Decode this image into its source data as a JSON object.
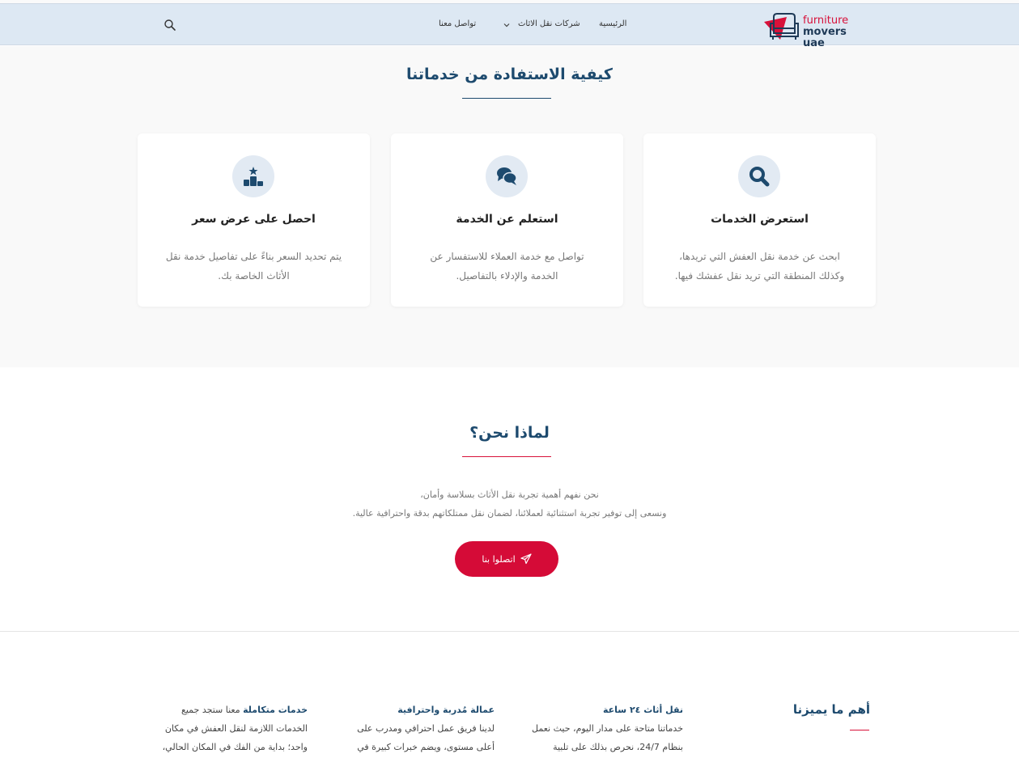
{
  "header": {
    "logo_line1": "furniture",
    "logo_line2": "movers uae",
    "nav": {
      "home": "الرئيسية",
      "companies": "شركات نقل الاثاث",
      "contact": "تواصل معنا"
    },
    "icons": {
      "search": "search-icon",
      "chevron": "chevron-down-icon",
      "logo": "armchair-icon"
    }
  },
  "how": {
    "title": "كيفية الاستفادة من خدماتنا",
    "cards": [
      {
        "icon": "search-icon",
        "title": "استعرض الخدمات",
        "line1": "ابحث عن خدمة نقل العفش التي تريدها،",
        "line2": "وكذلك المنطقة التي تريد نقل عفشك فيها."
      },
      {
        "icon": "chat-icon",
        "title": "استعلم عن الخدمة",
        "line1": "تواصل مع خدمة العملاء للاستفسار عن",
        "line2": "الخدمة والإدلاء بالتفاصيل."
      },
      {
        "icon": "podium-icon",
        "title": "احصل على عرض سعر",
        "line1": "يتم تحديد السعر بناءً على تفاصيل خدمة نقل",
        "line2": "الأثاث الخاصة بك."
      }
    ]
  },
  "why": {
    "title": "لماذا نحن؟",
    "line1": "نحن نفهم أهمية تجربة نقل الأثاث بسلاسة وأمان،",
    "line2": "ونسعى إلى توفير تجربة استثنائية لعملائنا، لضمان نقل ممتلكاتهم بدقة واحترافية عالية.",
    "cta_label": "اتصلوا بنا",
    "cta_icon": "send-icon"
  },
  "features": {
    "heading": "أهم ما يميزنا",
    "items": [
      {
        "title": "نقل أثاث ٢٤ ساعة",
        "text": "خدماتنا متاحة على مدار اليوم، حيث نعمل بنظام 24/7، نحرص بذلك على تلبية رغبات"
      },
      {
        "title": "عمالة مُدربة واحترافية",
        "text": "لدينا فريق عمل احترافي ومدرب على أعلى مستوى، ويضم خبرات كبيرة في مجال نقل"
      },
      {
        "title": "خدمات متكاملة",
        "text": "معنا ستجد جميع الخدمات اللازمة لنقل العفش في مكان واحد؛ بداية من الفك في المكان الحالي، وانتهاءً بالتركيب في"
      }
    ]
  },
  "colors": {
    "brand_red": "#d50b37",
    "navy": "#1d4a6e",
    "header_bg": "#dde8f3"
  }
}
